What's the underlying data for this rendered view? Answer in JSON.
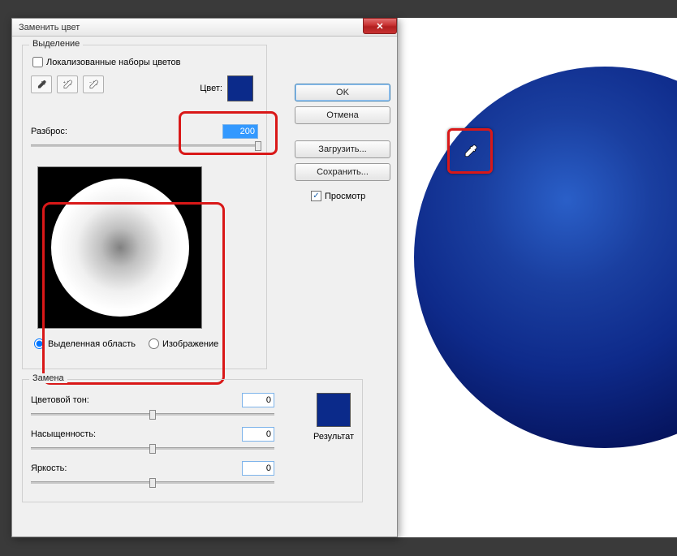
{
  "dialog": {
    "title": "Заменить цвет",
    "close_glyph": "✕"
  },
  "selection": {
    "legend": "Выделение",
    "localized_label": "Локализованные наборы цветов",
    "color_label": "Цвет:",
    "scatter_label": "Разброс:",
    "scatter_value": "200",
    "radio_selection": "Выделенная область",
    "radio_image": "Изображение"
  },
  "replace": {
    "legend": "Замена",
    "hue_label": "Цветовой тон:",
    "hue_value": "0",
    "saturation_label": "Насыщенность:",
    "saturation_value": "0",
    "lightness_label": "Яркость:",
    "lightness_value": "0",
    "result_label": "Результат"
  },
  "buttons": {
    "ok": "OK",
    "cancel": "Отмена",
    "load": "Загрузить...",
    "save": "Сохранить...",
    "preview": "Просмотр",
    "preview_checked": "✓"
  },
  "colors": {
    "swatch": "#0b2a8a",
    "highlight": "#d91818"
  }
}
